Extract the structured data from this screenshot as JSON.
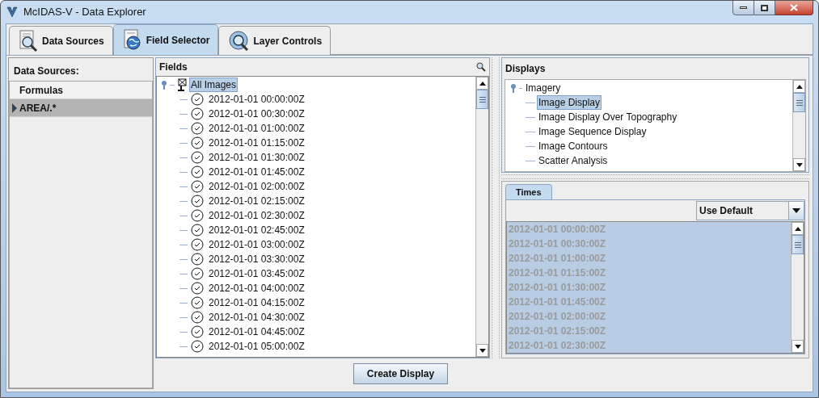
{
  "window": {
    "title": "McIDAS-V - Data Explorer"
  },
  "tabs": [
    {
      "label": "Data Sources",
      "selected": false,
      "kind": "sources"
    },
    {
      "label": "Field Selector",
      "selected": true,
      "kind": "fields"
    },
    {
      "label": "Layer Controls",
      "selected": false,
      "kind": "layers"
    }
  ],
  "data_sources": {
    "title": "Data Sources:",
    "items": [
      {
        "label": "Formulas",
        "selected": false
      },
      {
        "label": "AREA/.*",
        "selected": true
      }
    ]
  },
  "fields": {
    "title": "Fields",
    "tree": [
      {
        "label": "All Images",
        "selected": true,
        "expanded": true,
        "children": [
          {
            "label": "2012-01-01 00:00:00Z",
            "selected": false
          },
          {
            "label": "2012-01-01 00:30:00Z",
            "selected": false
          },
          {
            "label": "2012-01-01 01:00:00Z",
            "selected": false
          },
          {
            "label": "2012-01-01 01:15:00Z",
            "selected": false
          },
          {
            "label": "2012-01-01 01:30:00Z",
            "selected": false
          },
          {
            "label": "2012-01-01 01:45:00Z",
            "selected": false
          },
          {
            "label": "2012-01-01 02:00:00Z",
            "selected": false
          },
          {
            "label": "2012-01-01 02:15:00Z",
            "selected": false
          },
          {
            "label": "2012-01-01 02:30:00Z",
            "selected": false
          },
          {
            "label": "2012-01-01 02:45:00Z",
            "selected": false
          },
          {
            "label": "2012-01-01 03:00:00Z",
            "selected": false
          },
          {
            "label": "2012-01-01 03:30:00Z",
            "selected": false
          },
          {
            "label": "2012-01-01 03:45:00Z",
            "selected": false
          },
          {
            "label": "2012-01-01 04:00:00Z",
            "selected": false
          },
          {
            "label": "2012-01-01 04:15:00Z",
            "selected": false
          },
          {
            "label": "2012-01-01 04:30:00Z",
            "selected": false
          },
          {
            "label": "2012-01-01 04:45:00Z",
            "selected": false
          },
          {
            "label": "2012-01-01 05:00:00Z",
            "selected": false
          }
        ]
      }
    ]
  },
  "displays": {
    "title": "Displays",
    "tree": [
      {
        "label": "Imagery",
        "selected": false,
        "expanded": true,
        "children": [
          {
            "label": "Image Display",
            "selected": true
          },
          {
            "label": "Image Display Over Topography",
            "selected": false
          },
          {
            "label": "Image Sequence Display",
            "selected": false
          },
          {
            "label": "Image Contours",
            "selected": false
          },
          {
            "label": "Scatter Analysis",
            "selected": false
          }
        ]
      }
    ]
  },
  "times": {
    "tab": "Times",
    "mode": "Use Default",
    "disabled": true,
    "items": [
      {
        "label": "2012-01-01 00:00:00Z",
        "selected": true
      },
      {
        "label": "2012-01-01 00:30:00Z",
        "selected": true
      },
      {
        "label": "2012-01-01 01:00:00Z",
        "selected": true
      },
      {
        "label": "2012-01-01 01:15:00Z",
        "selected": true
      },
      {
        "label": "2012-01-01 01:30:00Z",
        "selected": true
      },
      {
        "label": "2012-01-01 01:45:00Z",
        "selected": true
      },
      {
        "label": "2012-01-01 02:00:00Z",
        "selected": true
      },
      {
        "label": "2012-01-01 02:15:00Z",
        "selected": true
      },
      {
        "label": "2012-01-01 02:30:00Z",
        "selected": true
      }
    ]
  },
  "buttons": [
    {
      "label": "Create Display"
    }
  ]
}
